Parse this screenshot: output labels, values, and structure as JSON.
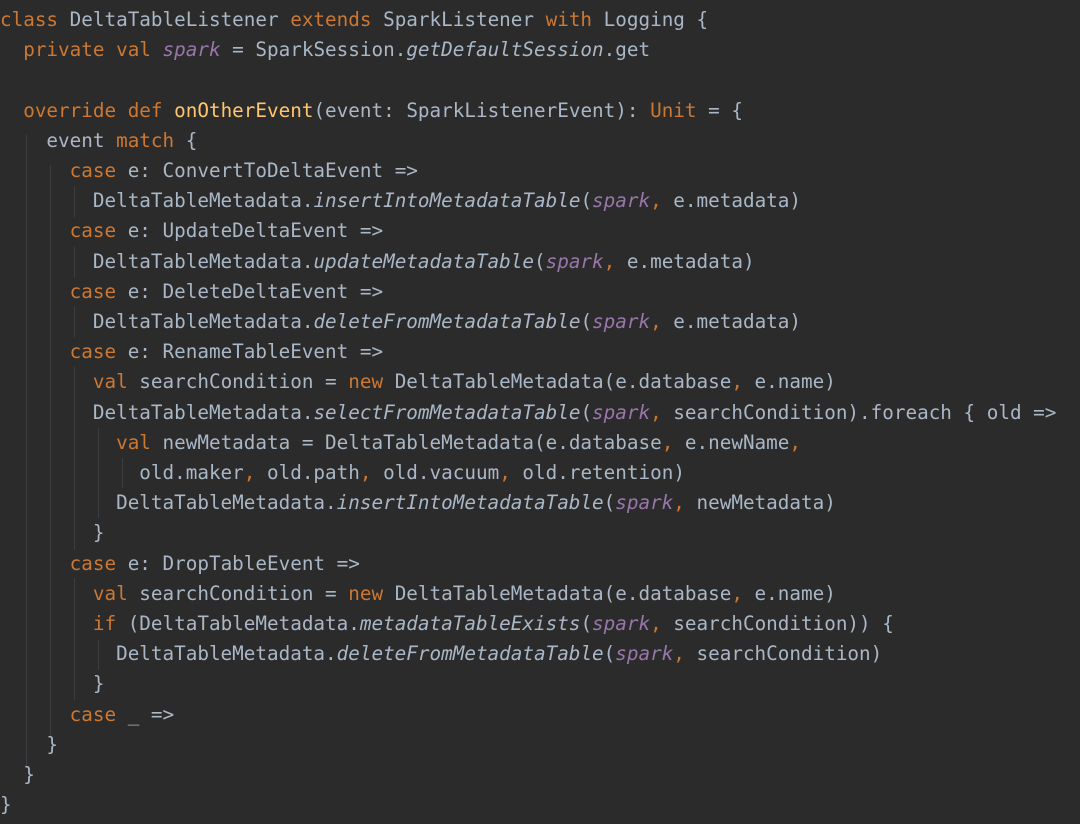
{
  "colors": {
    "background": "#2b2b2b",
    "keyword": "#cc7832",
    "plain": "#a9b7c6",
    "function_decl": "#ffc66d",
    "field": "#9876aa",
    "indent_guide": "#3c3f41"
  },
  "code_lines": [
    [
      {
        "t": "class",
        "k": "keyword"
      },
      {
        "t": " DeltaTableListener ",
        "k": "plain"
      },
      {
        "t": "extends",
        "k": "keyword"
      },
      {
        "t": " SparkListener ",
        "k": "plain"
      },
      {
        "t": "with",
        "k": "keyword"
      },
      {
        "t": " Logging {",
        "k": "plain"
      }
    ],
    [
      {
        "t": "  ",
        "k": "plain"
      },
      {
        "t": "private val",
        "k": "keyword"
      },
      {
        "t": " ",
        "k": "plain"
      },
      {
        "t": "spark",
        "k": "field"
      },
      {
        "t": " = SparkSession.",
        "k": "plain"
      },
      {
        "t": "getDefaultSession",
        "k": "italic"
      },
      {
        "t": ".get",
        "k": "plain"
      }
    ],
    [],
    [
      {
        "t": "  ",
        "k": "plain"
      },
      {
        "t": "override def",
        "k": "keyword"
      },
      {
        "t": " ",
        "k": "plain"
      },
      {
        "t": "onOtherEvent",
        "k": "func"
      },
      {
        "t": "(event: SparkListenerEvent): ",
        "k": "plain"
      },
      {
        "t": "Unit",
        "k": "keyword"
      },
      {
        "t": " = {",
        "k": "plain"
      }
    ],
    [
      {
        "t": "    event ",
        "k": "plain"
      },
      {
        "t": "match",
        "k": "keyword"
      },
      {
        "t": " {",
        "k": "plain"
      }
    ],
    [
      {
        "t": "      ",
        "k": "plain"
      },
      {
        "t": "case",
        "k": "keyword"
      },
      {
        "t": " e: ConvertToDeltaEvent =>",
        "k": "plain"
      }
    ],
    [
      {
        "t": "        DeltaTableMetadata.",
        "k": "plain"
      },
      {
        "t": "insertIntoMetadataTable",
        "k": "italic"
      },
      {
        "t": "(",
        "k": "plain"
      },
      {
        "t": "spark",
        "k": "field"
      },
      {
        "t": ",",
        "k": "keyword"
      },
      {
        "t": " e.metadata)",
        "k": "plain"
      }
    ],
    [
      {
        "t": "      ",
        "k": "plain"
      },
      {
        "t": "case",
        "k": "keyword"
      },
      {
        "t": " e: UpdateDeltaEvent =>",
        "k": "plain"
      }
    ],
    [
      {
        "t": "        DeltaTableMetadata.",
        "k": "plain"
      },
      {
        "t": "updateMetadataTable",
        "k": "italic"
      },
      {
        "t": "(",
        "k": "plain"
      },
      {
        "t": "spark",
        "k": "field"
      },
      {
        "t": ",",
        "k": "keyword"
      },
      {
        "t": " e.metadata)",
        "k": "plain"
      }
    ],
    [
      {
        "t": "      ",
        "k": "plain"
      },
      {
        "t": "case",
        "k": "keyword"
      },
      {
        "t": " e: DeleteDeltaEvent =>",
        "k": "plain"
      }
    ],
    [
      {
        "t": "        DeltaTableMetadata.",
        "k": "plain"
      },
      {
        "t": "deleteFromMetadataTable",
        "k": "italic"
      },
      {
        "t": "(",
        "k": "plain"
      },
      {
        "t": "spark",
        "k": "field"
      },
      {
        "t": ",",
        "k": "keyword"
      },
      {
        "t": " e.metadata)",
        "k": "plain"
      }
    ],
    [
      {
        "t": "      ",
        "k": "plain"
      },
      {
        "t": "case",
        "k": "keyword"
      },
      {
        "t": " e: RenameTableEvent =>",
        "k": "plain"
      }
    ],
    [
      {
        "t": "        ",
        "k": "plain"
      },
      {
        "t": "val",
        "k": "keyword"
      },
      {
        "t": " searchCondition = ",
        "k": "plain"
      },
      {
        "t": "new",
        "k": "keyword"
      },
      {
        "t": " DeltaTableMetadata(e.database",
        "k": "plain"
      },
      {
        "t": ",",
        "k": "keyword"
      },
      {
        "t": " e.name)",
        "k": "plain"
      }
    ],
    [
      {
        "t": "        DeltaTableMetadata.",
        "k": "plain"
      },
      {
        "t": "selectFromMetadataTable",
        "k": "italic"
      },
      {
        "t": "(",
        "k": "plain"
      },
      {
        "t": "spark",
        "k": "field"
      },
      {
        "t": ",",
        "k": "keyword"
      },
      {
        "t": " searchCondition).foreach { old =>",
        "k": "plain"
      }
    ],
    [
      {
        "t": "          ",
        "k": "plain"
      },
      {
        "t": "val",
        "k": "keyword"
      },
      {
        "t": " newMetadata = DeltaTableMetadata(e.database",
        "k": "plain"
      },
      {
        "t": ",",
        "k": "keyword"
      },
      {
        "t": " e.newName",
        "k": "plain"
      },
      {
        "t": ",",
        "k": "keyword"
      }
    ],
    [
      {
        "t": "            old.maker",
        "k": "plain"
      },
      {
        "t": ",",
        "k": "keyword"
      },
      {
        "t": " old.path",
        "k": "plain"
      },
      {
        "t": ",",
        "k": "keyword"
      },
      {
        "t": " old.vacuum",
        "k": "plain"
      },
      {
        "t": ",",
        "k": "keyword"
      },
      {
        "t": " old.retention)",
        "k": "plain"
      }
    ],
    [
      {
        "t": "          DeltaTableMetadata.",
        "k": "plain"
      },
      {
        "t": "insertIntoMetadataTable",
        "k": "italic"
      },
      {
        "t": "(",
        "k": "plain"
      },
      {
        "t": "spark",
        "k": "field"
      },
      {
        "t": ",",
        "k": "keyword"
      },
      {
        "t": " newMetadata)",
        "k": "plain"
      }
    ],
    [
      {
        "t": "        }",
        "k": "plain"
      }
    ],
    [
      {
        "t": "      ",
        "k": "plain"
      },
      {
        "t": "case",
        "k": "keyword"
      },
      {
        "t": " e: DropTableEvent =>",
        "k": "plain"
      }
    ],
    [
      {
        "t": "        ",
        "k": "plain"
      },
      {
        "t": "val",
        "k": "keyword"
      },
      {
        "t": " searchCondition = ",
        "k": "plain"
      },
      {
        "t": "new",
        "k": "keyword"
      },
      {
        "t": " DeltaTableMetadata(e.database",
        "k": "plain"
      },
      {
        "t": ",",
        "k": "keyword"
      },
      {
        "t": " e.name)",
        "k": "plain"
      }
    ],
    [
      {
        "t": "        ",
        "k": "plain"
      },
      {
        "t": "if",
        "k": "keyword"
      },
      {
        "t": " (DeltaTableMetadata.",
        "k": "plain"
      },
      {
        "t": "metadataTableExists",
        "k": "italic"
      },
      {
        "t": "(",
        "k": "plain"
      },
      {
        "t": "spark",
        "k": "field"
      },
      {
        "t": ",",
        "k": "keyword"
      },
      {
        "t": " searchCondition)) {",
        "k": "plain"
      }
    ],
    [
      {
        "t": "          DeltaTableMetadata.",
        "k": "plain"
      },
      {
        "t": "deleteFromMetadataTable",
        "k": "italic"
      },
      {
        "t": "(",
        "k": "plain"
      },
      {
        "t": "spark",
        "k": "field"
      },
      {
        "t": ",",
        "k": "keyword"
      },
      {
        "t": " searchCondition)",
        "k": "plain"
      }
    ],
    [
      {
        "t": "        }",
        "k": "plain"
      }
    ],
    [
      {
        "t": "      ",
        "k": "plain"
      },
      {
        "t": "case",
        "k": "keyword"
      },
      {
        "t": " _ =>",
        "k": "plain"
      }
    ],
    [
      {
        "t": "    }",
        "k": "plain"
      }
    ],
    [
      {
        "t": "  }",
        "k": "plain"
      }
    ],
    [
      {
        "t": "}",
        "k": "plain"
      }
    ]
  ]
}
